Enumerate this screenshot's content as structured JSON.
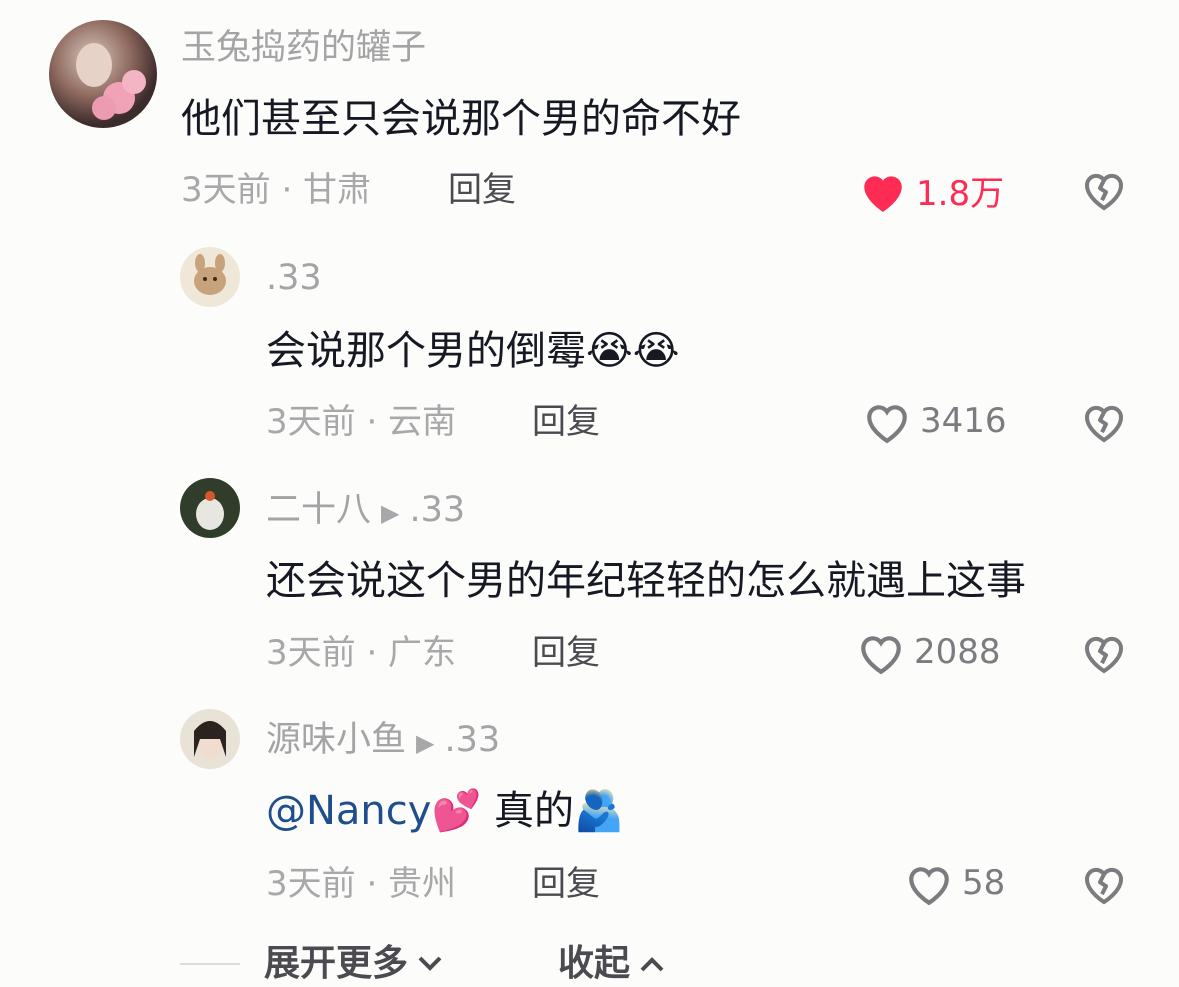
{
  "comment": {
    "username": "玉兔捣药的罐子",
    "text": "他们甚至只会说那个男的命不好",
    "meta": "3天前 · 甘肃",
    "reply_label": "回复",
    "likes": "1.8万",
    "liked": true
  },
  "replies": [
    {
      "username": ".33",
      "text": "会说那个男的倒霉",
      "emoji": "😭😭",
      "meta": "3天前 · 云南",
      "reply_label": "回复",
      "likes": "3416"
    },
    {
      "username": "二十八",
      "reply_to": ".33",
      "text": "还会说这个男的年纪轻轻的怎么就遇上这事",
      "meta": "3天前 · 广东",
      "reply_label": "回复",
      "likes": "2088"
    },
    {
      "username": "源味小鱼",
      "reply_to": ".33",
      "mention": "@Nancy",
      "mention_emoji": "💕",
      "text": "真的",
      "emoji": "🫂",
      "meta": "3天前 · 贵州",
      "reply_label": "回复",
      "likes": "58"
    }
  ],
  "footer": {
    "expand_label": "展开更多",
    "collapse_label": "收起"
  },
  "colors": {
    "liked": "#fe2c55",
    "mention": "#1f4e8c",
    "secondary_text": "#a8a8ab"
  }
}
